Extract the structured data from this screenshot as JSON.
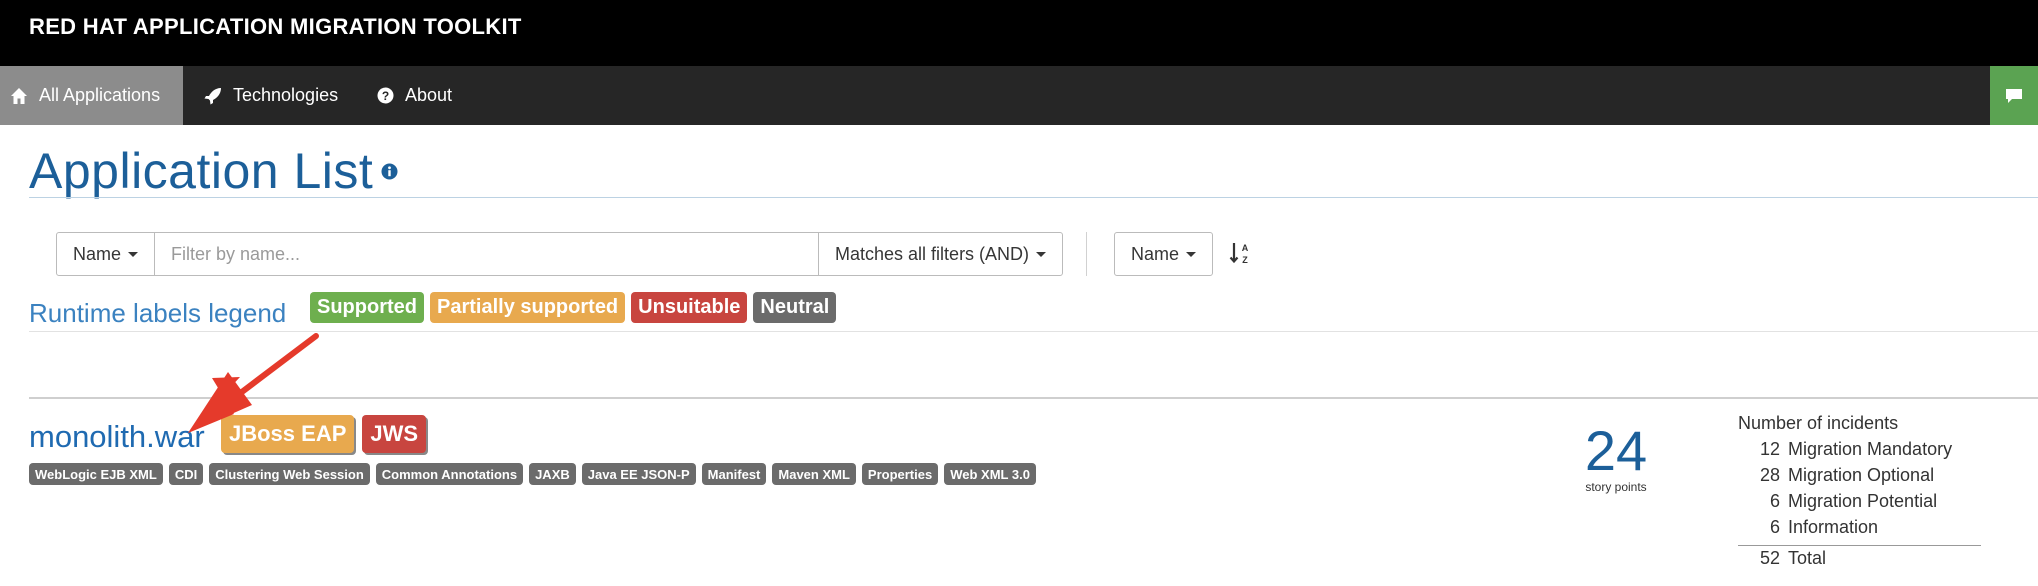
{
  "header": {
    "brand": "RED HAT APPLICATION MIGRATION TOOLKIT"
  },
  "nav": {
    "items": [
      {
        "label": "All Applications",
        "icon": "home-icon",
        "active": true
      },
      {
        "label": "Technologies",
        "icon": "rocket-icon",
        "active": false
      },
      {
        "label": "About",
        "icon": "question-circle-icon",
        "active": false
      }
    ],
    "chat_icon": "comment-icon"
  },
  "page": {
    "title": "Application List"
  },
  "filter": {
    "field_label": "Name",
    "placeholder": "Filter by name...",
    "match_label": "Matches all filters (AND)",
    "sort_label": "Name",
    "sort_icon": "sort-alpha-asc-icon"
  },
  "legend": {
    "label": "Runtime labels legend",
    "badges": [
      {
        "label": "Supported",
        "color": "#6eaf4e"
      },
      {
        "label": "Partially supported",
        "color": "#e8a94e"
      },
      {
        "label": "Unsuitable",
        "color": "#c8453f"
      },
      {
        "label": "Neutral",
        "color": "#6b6b6b"
      }
    ]
  },
  "application": {
    "name": "monolith.war",
    "runtimes": [
      {
        "label": "JBoss EAP",
        "color": "#e8a94e"
      },
      {
        "label": "JWS",
        "color": "#c8453f"
      }
    ],
    "technologies": [
      "WebLogic EJB XML",
      "CDI",
      "Clustering Web Session",
      "Common Annotations",
      "JAXB",
      "Java EE JSON-P",
      "Manifest",
      "Maven XML",
      "Properties",
      "Web XML 3.0"
    ],
    "story_points": "24",
    "story_points_label": "story points",
    "incidents": {
      "header": "Number of incidents",
      "rows": [
        {
          "count": "12",
          "label": "Migration Mandatory"
        },
        {
          "count": "28",
          "label": "Migration Optional"
        },
        {
          "count": "6",
          "label": "Migration Potential"
        },
        {
          "count": "6",
          "label": "Information"
        }
      ],
      "total_count": "52",
      "total_label": "Total"
    }
  },
  "colors": {
    "accent": "#1c5f99",
    "link": "#1f6ab1",
    "arrow": "#e53a2b"
  }
}
